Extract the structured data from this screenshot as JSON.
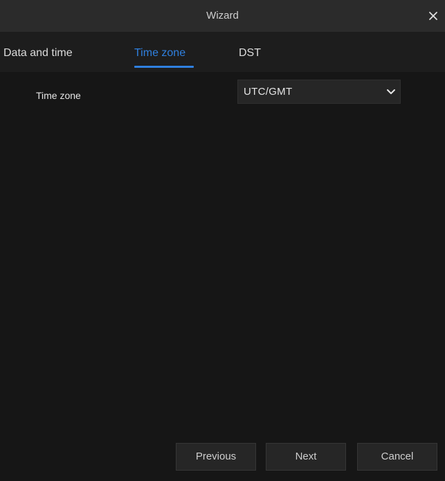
{
  "window": {
    "title": "Wizard",
    "close_icon": "close-icon"
  },
  "tabs": [
    {
      "label": "Data and time",
      "active": false
    },
    {
      "label": "Time zone",
      "active": true
    },
    {
      "label": "DST",
      "active": false
    }
  ],
  "form": {
    "time_zone_label": "Time zone",
    "time_zone_value": "UTC/GMT",
    "dropdown_icon": "chevron-down-icon"
  },
  "footer": {
    "previous_label": "Previous",
    "next_label": "Next",
    "cancel_label": "Cancel"
  },
  "colors": {
    "accent": "#2f80e0",
    "background": "#161616",
    "titlebar": "#2b2b2b",
    "tabbar": "#1d1d1d",
    "text": "#e6e6e6"
  }
}
